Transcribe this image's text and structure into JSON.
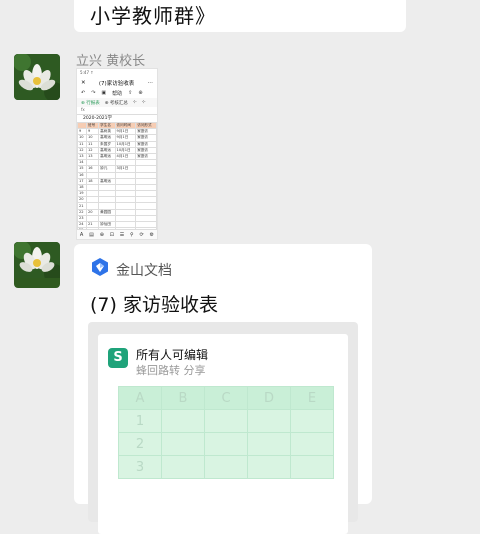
{
  "top_message": {
    "text": "小学教师群》"
  },
  "sender": {
    "name": "立兴  黄校长"
  },
  "screenshot": {
    "status": "5:47 ↑ ",
    "title": "(7)家访验收表",
    "toolbar": [
      "↶",
      "↷",
      "▣",
      "帮助",
      "⇪",
      "⊕"
    ],
    "tabs": [
      "⊕ 行报表",
      "⊕ 考核汇总",
      "⊹",
      "⊹"
    ],
    "formula": "fx",
    "section": "2020-2021学",
    "columns": [
      "",
      "班号",
      "学生名",
      "访问时间",
      "访问形式"
    ],
    "rows": [
      [
        "9",
        "9",
        "高树英",
        "9月1日",
        "家庭访"
      ],
      [
        "10",
        "10",
        "高明远",
        "9月1日",
        "家庭访"
      ],
      [
        "11",
        "11",
        "朱国岁",
        "10月1日",
        "家庭访"
      ],
      [
        "12",
        "12",
        "高明远",
        "10月1日",
        "家庭访"
      ],
      [
        "13",
        "13",
        "高明远",
        "4月1日",
        "家庭访"
      ],
      [
        "14",
        "",
        "",
        "",
        ""
      ],
      [
        "15",
        "16",
        "钟凡",
        "3月1日",
        ""
      ],
      [
        "16",
        "",
        "",
        "",
        ""
      ],
      [
        "17",
        "18",
        "高明远",
        "",
        ""
      ],
      [
        "18",
        "",
        "",
        "",
        ""
      ],
      [
        "19",
        "",
        "",
        "",
        ""
      ],
      [
        "20",
        "",
        "",
        "",
        ""
      ],
      [
        "21",
        "",
        "",
        "",
        ""
      ],
      [
        "22",
        "20",
        "黄园园",
        "",
        ""
      ],
      [
        "23",
        "",
        "",
        "",
        ""
      ],
      [
        "24",
        "21",
        "钟仙田",
        "",
        ""
      ],
      [
        "25",
        "",
        "",
        "",
        ""
      ],
      [
        "26",
        "22",
        "钟毛园",
        "",
        ""
      ],
      [
        "27",
        "",
        "",
        "",
        ""
      ],
      [
        "28",
        "23",
        "钟凡",
        "",
        ""
      ],
      [
        "29",
        "24",
        "",
        "",
        ""
      ],
      [
        "30",
        "25",
        "",
        "",
        ""
      ],
      [
        "31",
        "26",
        "",
        "",
        ""
      ],
      [
        "32",
        "27",
        "",
        "",
        ""
      ]
    ],
    "bottom": [
      "A",
      "▤",
      "⊕",
      "⊡",
      "☰",
      "⚲",
      "⟳",
      "⚙"
    ]
  },
  "card": {
    "app_name": "金山文档",
    "title": "(7) 家访验收表",
    "permission": "所有人可编辑",
    "share_by": "蜂回路转 分享",
    "sheet_icon": "S",
    "grid_cols": [
      "A",
      "B",
      "C",
      "D",
      "E"
    ],
    "grid_rows": [
      "1",
      "2",
      "3"
    ]
  },
  "colors": {
    "accent": "#1fa37a",
    "header_fill": "#f6cdb4",
    "grid_fill": "#d9f4e2"
  }
}
